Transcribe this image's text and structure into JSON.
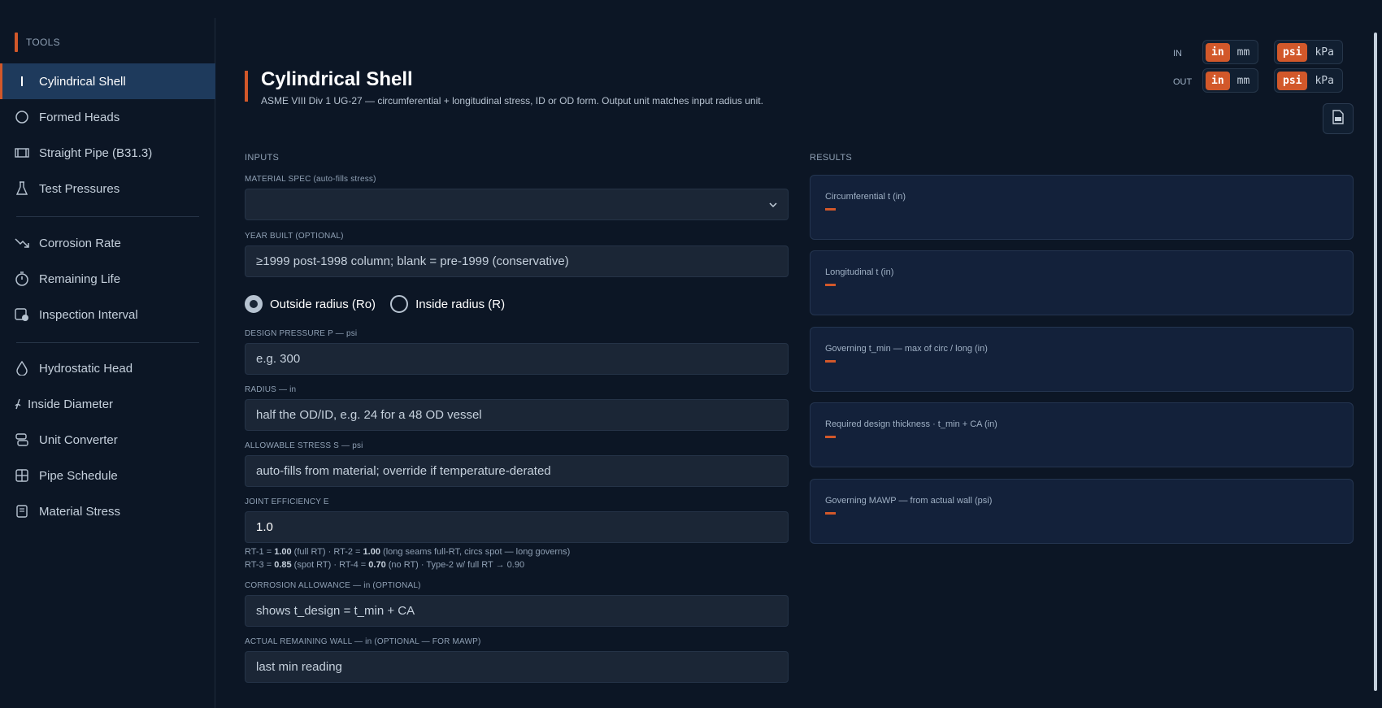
{
  "sidebar": {
    "header": "TOOLS",
    "groups": [
      [
        {
          "label": "Cylindrical Shell",
          "icon": "bar-icon",
          "active": true
        },
        {
          "label": "Formed Heads",
          "icon": "circle-icon"
        },
        {
          "label": "Straight Pipe (B31.3)",
          "icon": "pipe-icon"
        },
        {
          "label": "Test Pressures",
          "icon": "flask-icon"
        }
      ],
      [
        {
          "label": "Corrosion Rate",
          "icon": "trend-down-icon"
        },
        {
          "label": "Remaining Life",
          "icon": "timer-icon"
        },
        {
          "label": "Inspection Interval",
          "icon": "calendar-clock-icon"
        }
      ],
      [
        {
          "label": "Hydrostatic Head",
          "icon": "droplet-icon"
        },
        {
          "label": "Inside Diameter",
          "icon": "diameter-icon"
        },
        {
          "label": "Unit Converter",
          "icon": "converter-icon"
        },
        {
          "label": "Pipe Schedule",
          "icon": "grid-icon"
        },
        {
          "label": "Material Stress",
          "icon": "book-icon"
        }
      ]
    ]
  },
  "header": {
    "title": "Cylindrical Shell",
    "subtitle": "ASME VIII Div 1 UG-27 — circumferential + longitudinal stress, ID or OD form. Output unit matches input radius unit."
  },
  "units": {
    "in_label": "IN",
    "out_label": "OUT",
    "length": {
      "opt1": "in",
      "opt2": "mm",
      "selected": "in"
    },
    "pressure": {
      "opt1": "psi",
      "opt2": "kPa",
      "selected": "psi"
    }
  },
  "inputs": {
    "section_label": "INPUTS",
    "material": {
      "label": "MATERIAL SPEC (auto-fills stress)",
      "value": ""
    },
    "year": {
      "label": "YEAR BUILT (OPTIONAL)",
      "placeholder": "≥1999 post-1998 column; blank = pre-1999 (conservative)"
    },
    "radius_mode": {
      "outside": "Outside radius (Ro)",
      "inside": "Inside radius (R)",
      "selected": "outside"
    },
    "pressure": {
      "label": "DESIGN PRESSURE P — psi",
      "placeholder": "e.g. 300"
    },
    "radius": {
      "label": "RADIUS — in",
      "placeholder": "half the OD/ID, e.g. 24 for a 48 OD vessel"
    },
    "stress": {
      "label": "ALLOWABLE STRESS S — psi",
      "placeholder": "auto-fills from material; override if temperature-derated"
    },
    "efficiency": {
      "label": "JOINT EFFICIENCY E",
      "value": "1.0"
    },
    "hint1": {
      "a": "RT-1 = ",
      "a_val": "1.00",
      "a_note": " (full RT)  ·  ",
      "b": "RT-2 = ",
      "b_val": "1.00",
      "b_note": " (long seams full-RT, circs spot — long governs)"
    },
    "hint2": {
      "a": "RT-3 = ",
      "a_val": "0.85",
      "a_note": " (spot RT)  ·  ",
      "b": "RT-4 = ",
      "b_val": "0.70",
      "b_note": " (no RT)  ·  Type-2 w/ full RT → 0.90"
    },
    "corrosion": {
      "label": "CORROSION ALLOWANCE — in (OPTIONAL)",
      "placeholder": "shows t_design = t_min + CA"
    },
    "wall": {
      "label": "ACTUAL REMAINING WALL — in (OPTIONAL — FOR MAWP)",
      "placeholder": "last min reading"
    }
  },
  "results": {
    "section_label": "RESULTS",
    "items": [
      {
        "label": "Circumferential t (in)",
        "value": "—"
      },
      {
        "label": "Longitudinal t (in)",
        "value": "—"
      },
      {
        "label": "Governing t_min — max of circ / long (in)",
        "value": "—"
      },
      {
        "label": "Required design thickness · t_min + CA (in)",
        "value": "—"
      },
      {
        "label": "Governing MAWP — from actual wall (psi)",
        "value": "—"
      }
    ]
  },
  "colors": {
    "accent": "#d2582a",
    "bg": "#0c1625",
    "active_nav": "#1e3a5c",
    "card": "#13213a"
  }
}
